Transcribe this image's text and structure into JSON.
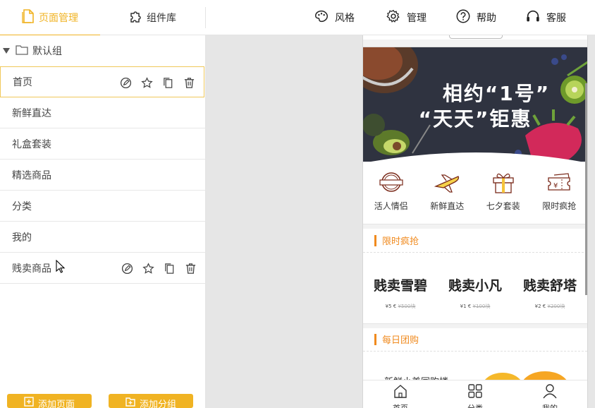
{
  "topbar": {
    "tabs": [
      {
        "label": "页面管理",
        "icon": "page-icon",
        "active": true
      },
      {
        "label": "组件库",
        "icon": "puzzle-icon",
        "active": false
      }
    ],
    "nav": [
      {
        "label": "风格",
        "icon": "palette-icon"
      },
      {
        "label": "管理",
        "icon": "gear-icon"
      },
      {
        "label": "帮助",
        "icon": "help-icon"
      },
      {
        "label": "客服",
        "icon": "headset-icon"
      }
    ]
  },
  "sidebar": {
    "group_name": "默认组",
    "pages": [
      {
        "label": "首页"
      },
      {
        "label": "新鲜直达"
      },
      {
        "label": "礼盒套装"
      },
      {
        "label": "精选商品"
      },
      {
        "label": "分类"
      },
      {
        "label": "我的"
      },
      {
        "label": "贱卖商品"
      }
    ],
    "add_page_label": "添加页面",
    "add_group_label": "添加分组"
  },
  "preview": {
    "banner": {
      "line1": "相约“1号”",
      "line2": "“天天”钜惠"
    },
    "quick_nav": [
      {
        "label": "活人情侣",
        "icon": "badge-icon"
      },
      {
        "label": "新鲜直达",
        "icon": "airplane-icon"
      },
      {
        "label": "七夕套装",
        "icon": "gift-icon"
      },
      {
        "label": "限时疯抢",
        "icon": "coupon-icon"
      }
    ],
    "flash_section_title": "限时疯抢",
    "flash_items": [
      {
        "name": "贱卖雪碧",
        "price": "¥5 €",
        "old_price": "¥500块"
      },
      {
        "name": "贱卖小凡",
        "price": "¥1 €",
        "old_price": "¥100块"
      },
      {
        "name": "贱卖舒塔",
        "price": "¥2 €",
        "old_price": "¥200块"
      }
    ],
    "group_section_title": "每日团购",
    "group_snippet": "新鲜小美同购楼",
    "tabbar": [
      {
        "label": "首页",
        "icon": "home-icon"
      },
      {
        "label": "分类",
        "icon": "grid-icon"
      },
      {
        "label": "我的",
        "icon": "user-icon"
      }
    ]
  },
  "colors": {
    "accent": "#f0b323",
    "section_orange": "#f08a1e"
  }
}
